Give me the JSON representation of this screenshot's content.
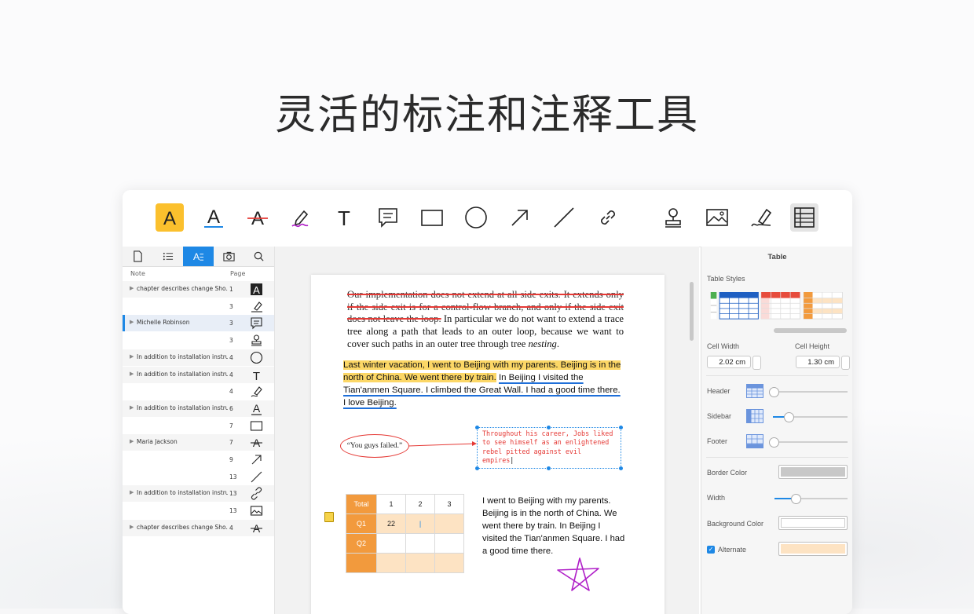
{
  "headline": "灵活的标注和注释工具",
  "toolbar": {
    "tools": [
      "highlight-icon",
      "underline-icon",
      "strikethrough-icon",
      "freehand-icon",
      "text-icon",
      "note-icon",
      "rectangle-icon",
      "circle-icon",
      "arrow-icon",
      "line-icon",
      "link-icon",
      "stamp-icon",
      "image-icon",
      "signature-icon",
      "table-icon"
    ],
    "highlight_glyph": "A",
    "underline_glyph": "A",
    "strike_glyph": "A",
    "text_glyph": "T"
  },
  "sidebar": {
    "tabs": [
      "page-thumbnail-icon",
      "outline-icon",
      "annotations-icon",
      "snapshot-icon",
      "search-icon"
    ],
    "col_note": "Note",
    "col_page": "Page",
    "rows": [
      {
        "note": "chapter describes change Sho...",
        "page": "1",
        "icon": "highlight-A"
      },
      {
        "note": "",
        "page": "3",
        "icon": "signature"
      },
      {
        "note": "Michelle Robinson",
        "page": "3",
        "icon": "note"
      },
      {
        "note": "",
        "page": "3",
        "icon": "stamp"
      },
      {
        "note": "In addition to installation instru...",
        "page": "4",
        "icon": "circle"
      },
      {
        "note": "In addition to installation instru...",
        "page": "4",
        "icon": "text-T"
      },
      {
        "note": "",
        "page": "4",
        "icon": "freehand"
      },
      {
        "note": "In addition to installation instru...",
        "page": "6",
        "icon": "underline-A"
      },
      {
        "note": "",
        "page": "7",
        "icon": "rectangle"
      },
      {
        "note": "Maria Jackson",
        "page": "7",
        "icon": "strike-A"
      },
      {
        "note": "",
        "page": "9",
        "icon": "arrow"
      },
      {
        "note": "",
        "page": "13",
        "icon": "line"
      },
      {
        "note": "In addition to installation instru...",
        "page": "13",
        "icon": "link"
      },
      {
        "note": "",
        "page": "13",
        "icon": "image"
      },
      {
        "note": "chapter describes change Sho...",
        "page": "4",
        "icon": "strike-A"
      }
    ],
    "icon_glyph_A": "A",
    "icon_glyph_T": "T"
  },
  "document": {
    "para1_strike": "Our implementation does not extend at all side exits. It extends only if the side exit is for a control-flow branch, and only if the side exit does not leave the loop.",
    "para1_rest": " In particular we do not want to extend a trace tree along a path that leads to an outer loop, because we want to cover such paths in an outer tree through tree ",
    "para1_italic": "nesting",
    "para1_end": ".",
    "para2_highlight": "Last winter vacation, I went to Beijing with my parents. Beijing is in the north of China. We went there by train.",
    "para2_underline": "In Beijing I visited the Tian'anmen Square. I climbed the Great Wall. I had a good time there. I love Beijing.",
    "bubble_text": "“You guys failed.”",
    "callout_text": "Throughout his career, Jobs liked to see himself as an enlightened rebel pitted against evil empires",
    "table": {
      "header": [
        "Total",
        "1",
        "2",
        "3"
      ],
      "rows": [
        {
          "label": "Q1",
          "cells": [
            "22",
            "|",
            ""
          ]
        },
        {
          "label": "Q2",
          "cells": [
            "",
            "",
            ""
          ]
        },
        {
          "label": "",
          "cells": [
            "",
            "",
            ""
          ]
        }
      ]
    },
    "para3": "I went to Beijing with my parents. Beijing is in the north of China. We went there by train. In Beijing I visited the Tian'anmen Square. I had a good time there."
  },
  "panel": {
    "title": "Table",
    "table_styles_label": "Table Styles",
    "cell_width_label": "Cell Width",
    "cell_height_label": "Cell Height",
    "cell_width_value": "2.02 cm",
    "cell_height_value": "1.30 cm",
    "header_label": "Header",
    "sidebar_label": "Sidebar",
    "footer_label": "Footer",
    "header_level": 0.0,
    "sidebar_level": 0.2,
    "footer_level": 0.0,
    "border_color_label": "Border Color",
    "width_label": "Width",
    "width_level": 0.28,
    "background_color_label": "Background Color",
    "alternate_label": "Alternate",
    "alternate_checked": true,
    "border_color": "#c8c8c8",
    "background_color": "#ffffff",
    "alternate_color": "#fde3c3",
    "style_colors": [
      "#4caf50",
      "#1e5fc2",
      "#e74c3c",
      "#f29a3d"
    ]
  },
  "colors": {
    "accent": "#1e88e5",
    "highlight": "#fcd766",
    "annotation_red": "#e53935",
    "freehand_purple": "#b020c8"
  }
}
